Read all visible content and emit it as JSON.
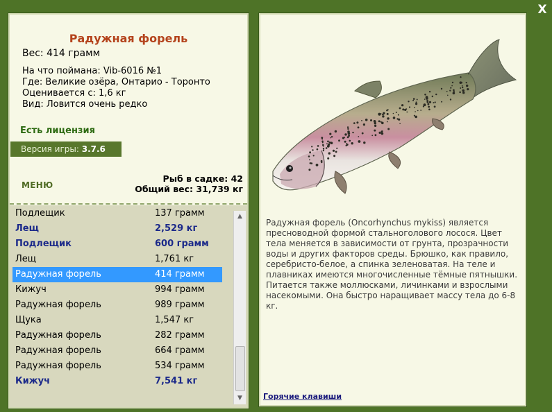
{
  "window": {
    "close_label": "X"
  },
  "fish": {
    "title": "Радужная форель",
    "weight": "Вес: 414 грамм",
    "caught_on": "На что поймана: Vib-6016 №1",
    "location": "Где: Великие озёра, Онтарио - Торонто",
    "valued": "Оценивается с: 1,6 кг",
    "rarity": "Вид: Ловится очень редко"
  },
  "license": "Есть лицензия",
  "version": {
    "label": "Версия игры:",
    "value": "3.7.6"
  },
  "menu_label": "МЕНЮ",
  "stats": {
    "fish_count": "Рыб в садке: 42",
    "total_weight": "Общий вес: 31,739 кг"
  },
  "catch_list": [
    {
      "name": "Подлещик",
      "weight": "137 грамм",
      "bold": false,
      "selected": false
    },
    {
      "name": "Лещ",
      "weight": "2,529 кг",
      "bold": true,
      "selected": false
    },
    {
      "name": "Подлещик",
      "weight": "600 грамм",
      "bold": true,
      "selected": false
    },
    {
      "name": "Лещ",
      "weight": "1,761 кг",
      "bold": false,
      "selected": false
    },
    {
      "name": "Радужная форель",
      "weight": "414 грамм",
      "bold": false,
      "selected": true
    },
    {
      "name": "Кижуч",
      "weight": "994 грамм",
      "bold": false,
      "selected": false
    },
    {
      "name": "Радужная форель",
      "weight": "989 грамм",
      "bold": false,
      "selected": false
    },
    {
      "name": "Щука",
      "weight": "1,547 кг",
      "bold": false,
      "selected": false
    },
    {
      "name": "Радужная форель",
      "weight": "282 грамм",
      "bold": false,
      "selected": false
    },
    {
      "name": "Радужная форель",
      "weight": "664 грамм",
      "bold": false,
      "selected": false
    },
    {
      "name": "Радужная форель",
      "weight": "534 грамм",
      "bold": false,
      "selected": false
    },
    {
      "name": "Кижуч",
      "weight": "7,541 кг",
      "bold": true,
      "selected": false
    }
  ],
  "description": "Радужная форель (Oncorhynchus mykiss) является пресноводной формой стальноголового лосося. Цвет тела меняется в зависимости от грунта, прозрачности воды и других факторов среды. Брюшко, как правило, серебристо-белое, а спинка зеленоватая. На теле и плавниках имеются многочисленные тёмные пятнышки. Питается также моллюсками, личинками и взрослыми насекомыми. Она быстро наращивает массу тела до 6-8 кг.",
  "hotkeys_label": "Горячие клавиши",
  "colors": {
    "background": "#4e7327",
    "panel": "#f7f8e6",
    "title": "#b4431c",
    "license": "#2d6a12",
    "selected_row": "#3399ff",
    "bold_row": "#1c2a8a"
  },
  "icons": {
    "close": "close-icon",
    "scroll_up": "arrow-up-icon",
    "scroll_down": "arrow-down-icon"
  }
}
